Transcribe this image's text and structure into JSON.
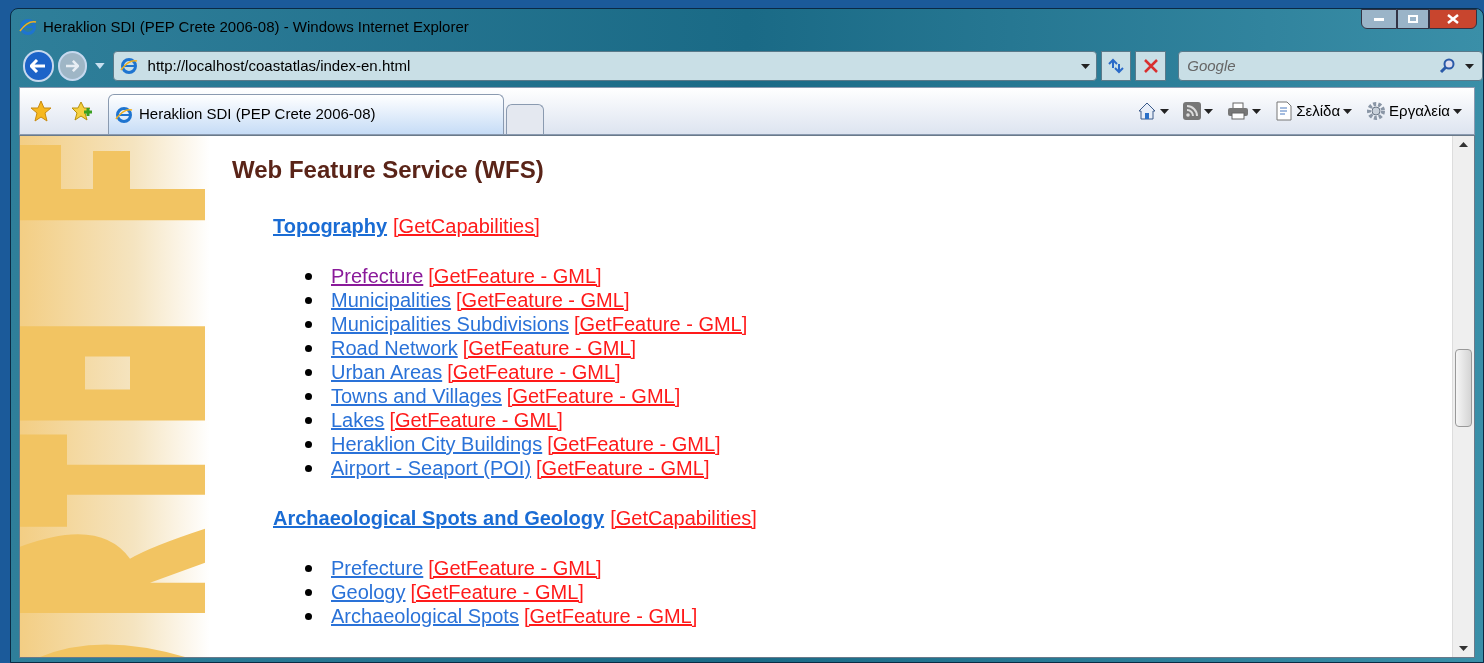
{
  "window": {
    "title": "Heraklion SDI (PEP Crete 2006-08) - Windows Internet Explorer"
  },
  "address_bar": {
    "url": "http://localhost/coastatlas/index-en.html"
  },
  "search": {
    "placeholder": "Google"
  },
  "tabs": [
    {
      "label": "Heraklion SDI (PEP Crete 2006-08)",
      "selected": true
    }
  ],
  "command_bar": [
    {
      "kind": "home"
    },
    {
      "kind": "feeds"
    },
    {
      "kind": "print"
    },
    {
      "kind": "page",
      "label": "Σελίδα"
    },
    {
      "kind": "tools",
      "label": "Εργαλεία"
    }
  ],
  "page": {
    "heading": "Web Feature Service (WFS)",
    "sections": [
      {
        "title": "Topography",
        "capabilities": "[GetCapabilities]",
        "layers": [
          {
            "name": "Prefecture",
            "action": "[GetFeature - GML]",
            "visited": true
          },
          {
            "name": "Municipalities",
            "action": "[GetFeature - GML]",
            "visited": false
          },
          {
            "name": "Municipalities Subdivisions",
            "action": "[GetFeature - GML]",
            "visited": false
          },
          {
            "name": "Road Network",
            "action": "[GetFeature - GML]",
            "visited": false
          },
          {
            "name": "Urban Areas",
            "action": "[GetFeature - GML]",
            "visited": false
          },
          {
            "name": "Towns and Villages",
            "action": "[GetFeature - GML]",
            "visited": false
          },
          {
            "name": "Lakes",
            "action": "[GetFeature - GML]",
            "visited": false
          },
          {
            "name": "Heraklion City Buildings",
            "action": "[GetFeature - GML]",
            "visited": false
          },
          {
            "name": "Airport - Seaport (POI)",
            "action": "[GetFeature - GML]",
            "visited": false
          }
        ]
      },
      {
        "title": "Archaeological Spots and Geology",
        "capabilities": "[GetCapabilities]",
        "layers": [
          {
            "name": "Prefecture",
            "action": "[GetFeature - GML]",
            "visited": false
          },
          {
            "name": "Geology",
            "action": "[GetFeature - GML]",
            "visited": false
          },
          {
            "name": "Archaeological Spots",
            "action": "[GetFeature - GML]",
            "visited": false
          }
        ]
      }
    ]
  }
}
